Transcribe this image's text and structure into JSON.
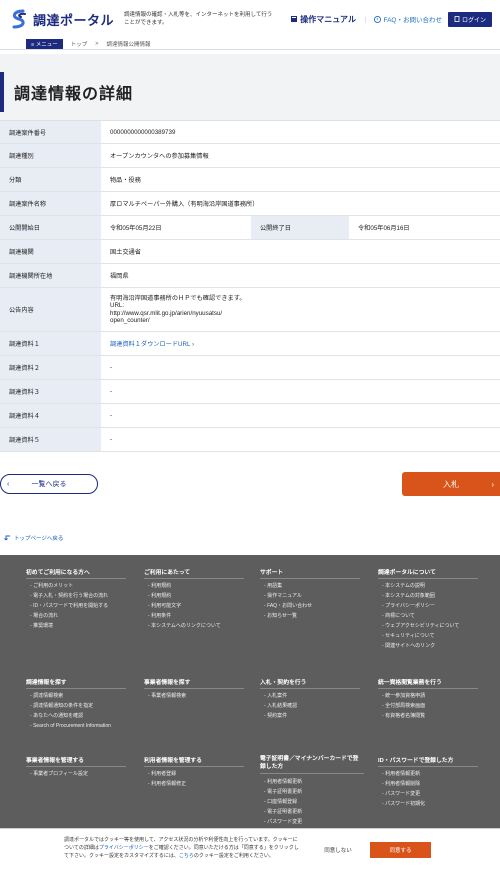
{
  "header": {
    "logo_text": "調達ポータル",
    "tagline": "調達情報の確認・入札等を、インターネットを利用して行うことができます。",
    "manual": "操作マニュアル",
    "sep": "｜",
    "faq": "FAQ・お問い合わせ",
    "login": "ログイン"
  },
  "breadcrumb": {
    "menu": "メニュー",
    "top": "トップ",
    "arrow": ">",
    "current": "調達情報公開情報"
  },
  "page_title": "調達情報の詳細",
  "table": {
    "case_no_label": "調達案件番号",
    "case_no": "0000000000000389739",
    "type_label": "調達種別",
    "type": "オープンカウンタへの参加募集情報",
    "category_label": "分類",
    "category": "物品・役務",
    "name_label": "調達案件名称",
    "name": "厚ロマルチペーパー外購入（有明海沿岸国道事務所）",
    "pub_start_label": "公開開始日",
    "pub_start": "令和05年05月22日",
    "pub_end_label": "公開終了日",
    "pub_end": "令和05年06月16日",
    "org_label": "調達機関",
    "org": "国土交通省",
    "location_label": "調達機関所在地",
    "location": "福岡県",
    "content_label": "公告内容",
    "content_l1": "有明海沿岸国道事務所のＨＰでも確認できます。",
    "content_l2": "URL:",
    "content_l3": "http://www.qsr.mlit.go.jp/arien/nyuusatsu/",
    "content_l4": "open_counter/",
    "doc1_label": "調達資料１",
    "doc1": "調達資料１ダウンロードURL",
    "doc2_label": "調達資料２",
    "doc2": "-",
    "doc3_label": "調達資料３",
    "doc3": "-",
    "doc4_label": "調達資料４",
    "doc4": "-",
    "doc5_label": "調達資料５",
    "doc5": "-"
  },
  "buttons": {
    "back": "一覧へ戻る",
    "bid": "入札",
    "chevron_left": "‹",
    "chevron_right": "›"
  },
  "top_link": "トップページへ戻る",
  "footer": {
    "s1_title": "初めてご利用になる方へ",
    "s1_items": [
      "ご利用のメリット",
      "電子入札・契約を行う場合の流れ",
      "ID・パスワードで利用を開始する",
      "場合の流れ",
      "推奨環境"
    ],
    "s2_title": "ご利用にあたって",
    "s2_items": [
      "利用規約",
      "利用規約",
      "利用可能文字",
      "利用条件",
      "本システムへのリンクについて"
    ],
    "s3_title": "サポート",
    "s3_items": [
      "用語集",
      "操作マニュアル",
      "FAQ・お問い合わせ",
      "お知らせ一覧"
    ],
    "s4_title": "調達ポータルについて",
    "s4_items": [
      "本システムの説明",
      "本システムの対象範囲",
      "プライバシーポリシー",
      "商標について",
      "ウェブアクセシビリティについて",
      "セキュリティについて",
      "関連サイトへのリンク"
    ],
    "s5_title": "調達情報を探す",
    "s5_items": [
      "調達情報検索",
      "調達情報通知の条件を指定",
      "あなたへの通知を確認",
      "Search of Procurement Information"
    ],
    "s6_title": "事業者情報を探す",
    "s6_items": [
      "事業者情報検索"
    ],
    "s7_title": "入札・契約を行う",
    "s7_items": [
      "入札案件",
      "入札結果確認",
      "契約案件"
    ],
    "s8_title": "統一資格閲覧業務を行う",
    "s8_items": [
      "統一参加資格申請",
      "全付部局検索画面",
      "有資格者名簿閲覧"
    ],
    "s9_title": "事業者情報を管理する",
    "s9_items": [
      "事業者プロフィール設定"
    ],
    "s10_title": "利用者情報を管理する",
    "s10_items": [
      "利用者登録",
      "利用者情報修正"
    ],
    "s11_title": "電子証明書／マイナンバーカードで登録した方",
    "s11_items": [
      "利用者情報更新",
      "電子証明書更新",
      "口座情報登録",
      "電子証明書更新",
      "パスワード変更"
    ],
    "s12_title": "ID・パスワードで登録した方",
    "s12_items": [
      "利用者情報更新",
      "利用者情報削除",
      "パスワード変更",
      "パスワード初期化"
    ]
  },
  "cookie": {
    "text1": "調達ポータルではクッキー等を使用して、アクセス状況の分析や利便性向上を行っています。クッキーについての詳細は",
    "policy": "プライバシーポリシー",
    "text2": "をご確認ください。同意いただける方は「同意する」をクリックして下さい。クッキー設定をカスタマイズするには、",
    "here": "こちら",
    "text3": "のクッキー設定をご利用ください。",
    "decline": "同意しない",
    "accept": "同意する"
  },
  "colors": {
    "brand": "#1c2a80",
    "accent": "#d9541b",
    "label_bg": "#e8ecf5",
    "footer_bg": "#5d5d5d"
  }
}
